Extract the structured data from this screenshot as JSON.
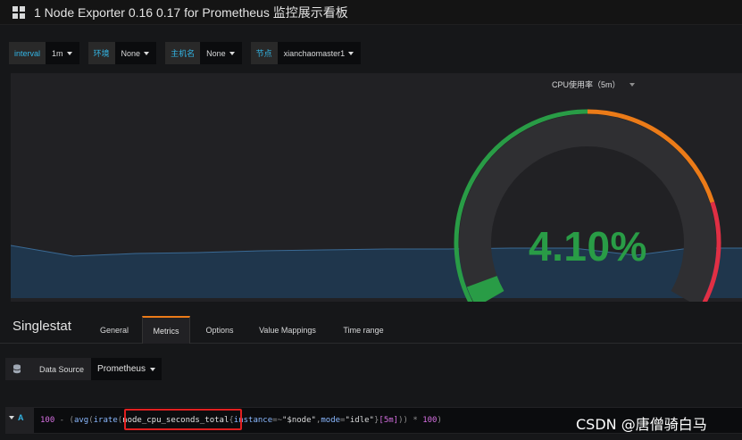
{
  "nav": {
    "dashboard_title": "1 Node Exporter 0.16 0.17 for Prometheus 监控展示看板"
  },
  "variables": [
    {
      "label": "interval",
      "value": "1m"
    },
    {
      "label": "环境",
      "value": "None"
    },
    {
      "label": "主机名",
      "value": "None"
    },
    {
      "label": "节点",
      "value": "xianchaomaster1"
    }
  ],
  "panel": {
    "title": "CPU使用率（5m）",
    "value_text": "4.10%",
    "value": 4.1,
    "thresholds_colors": [
      "#299c46",
      "#eb7b18",
      "#e02f44"
    ],
    "value_color": "#299c46"
  },
  "editor": {
    "title": "Singlestat",
    "tabs": [
      "General",
      "Metrics",
      "Options",
      "Value Mappings",
      "Time range"
    ],
    "active_tab": "Metrics"
  },
  "datasource": {
    "label": "Data Source",
    "value": "Prometheus"
  },
  "query": {
    "ref_id": "A",
    "tokens": {
      "t1": "100",
      "t2": " - ",
      "t3": "(",
      "t4": "avg",
      "t5": "(",
      "t6": "irate",
      "t7": "(",
      "t8": "node_cpu_seconds_total",
      "t9": "{",
      "t10": "instance",
      "t11": "=~",
      "t12": "\"$node\"",
      "t13": ",",
      "t14": "mode",
      "t15": "=",
      "t16": "\"idle\"",
      "t17": "}",
      "t18": "[5m]",
      "t19": "))",
      "t20": " * ",
      "t21": "100",
      "t22": ")"
    }
  },
  "watermark": "CSDN @唐僧骑白马"
}
